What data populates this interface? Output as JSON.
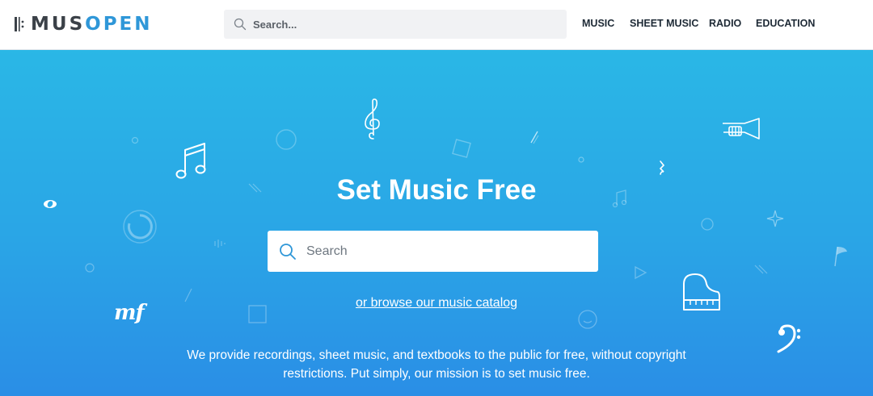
{
  "header": {
    "logo": {
      "part1": "MUS",
      "part2": "OPEN"
    },
    "search": {
      "placeholder": "Search..."
    },
    "nav": [
      {
        "label": "MUSIC"
      },
      {
        "label": "SHEET MUSIC"
      },
      {
        "label": "RADIO"
      },
      {
        "label": "EDUCATION"
      }
    ]
  },
  "hero": {
    "title": "Set Music Free",
    "search_placeholder": "Search",
    "browse_link": "or browse our music catalog",
    "mission_line1": "We provide recordings, sheet music, and textbooks to the public for free, without copyright",
    "mission_line2": "restrictions. Put simply, our mission is to set music free.",
    "dynamic_mark": "mf"
  },
  "colors": {
    "brand_dark": "#3b4148",
    "brand_blue": "#2f97d8",
    "hero_top": "#2ab7e6",
    "hero_bottom": "#2a8ee6"
  }
}
